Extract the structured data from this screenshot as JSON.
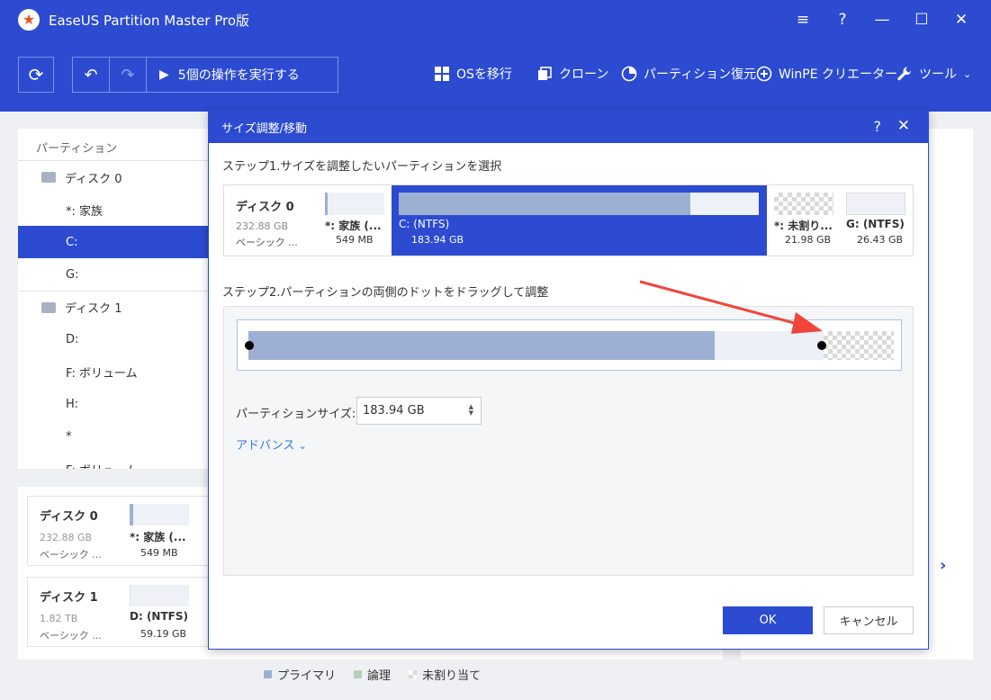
{
  "app": {
    "title": "EaseUS Partition Master Pro版"
  },
  "window_controls": {
    "menu": "≡",
    "help": "?",
    "minimize": "—",
    "maximize": "☐",
    "close": "✕"
  },
  "toolbar": {
    "execute_label": "5個の操作を実行する",
    "os_migrate": "OSを移行",
    "clone": "クローン",
    "partition_recovery": "パーティション復元",
    "winpe": "WinPE クリエーター",
    "tools": "ツール"
  },
  "left_panel": {
    "header": "パーティション",
    "rows": [
      {
        "type": "disk",
        "label": "ディスク 0"
      },
      {
        "type": "part",
        "label": "*: 家族"
      },
      {
        "type": "part",
        "label": "C:",
        "selected": true
      },
      {
        "type": "part",
        "label": "G:"
      },
      {
        "type": "disk",
        "label": "ディスク 1"
      },
      {
        "type": "part",
        "label": "D:"
      },
      {
        "type": "part",
        "label": "F: ボリューム"
      },
      {
        "type": "part",
        "label": "H:"
      },
      {
        "type": "part",
        "label": "*"
      },
      {
        "type": "part",
        "label": "F: ボリューム"
      }
    ]
  },
  "bottom_cards": [
    {
      "name": "ディスク 0",
      "size": "232.88 GB",
      "type": "ベーシック ...",
      "part_name": "*: 家族 (...",
      "part_size": "549 MB"
    },
    {
      "name": "ディスク 1",
      "size": "1.82 TB",
      "type": "ベーシック ...",
      "part_name": "D: (NTFS)",
      "part_size": "59.19 GB"
    }
  ],
  "legend": {
    "primary": "プライマリ",
    "logical": "論理",
    "unallocated": "未割り当て"
  },
  "colors": {
    "brand": "#2c4bd1",
    "partition_fill": "#9db0d3",
    "link": "#2c7be5",
    "arrow": "#f0453a"
  },
  "dialog": {
    "title": "サイズ調整/移動",
    "help": "?",
    "close": "✕",
    "step1": "ステップ1.サイズを調整したいパーティションを選択",
    "step2": "ステップ2.パーティションの両側のドットをドラッグして調整",
    "disk": {
      "name": "ディスク 0",
      "size": "232.88 GB",
      "type": "ベーシック ..."
    },
    "partitions": [
      {
        "label": "*: 家族 (...",
        "size": "549 MB",
        "used": 0.05
      },
      {
        "label": "C: (NTFS)",
        "size": "183.94 GB",
        "used": 0.81,
        "selected": true
      },
      {
        "label": "*: 未割り...",
        "size": "21.98 GB",
        "unallocated": true
      },
      {
        "label": "G: (NTFS)",
        "size": "26.43 GB",
        "used": 0.0
      }
    ],
    "resize": {
      "used_fraction": 0.81
    },
    "size_label": "パーティションサイズ:",
    "size_value": "183.94 GB",
    "advanced": "アドバンス",
    "ok": "OK",
    "cancel": "キャンセル"
  }
}
